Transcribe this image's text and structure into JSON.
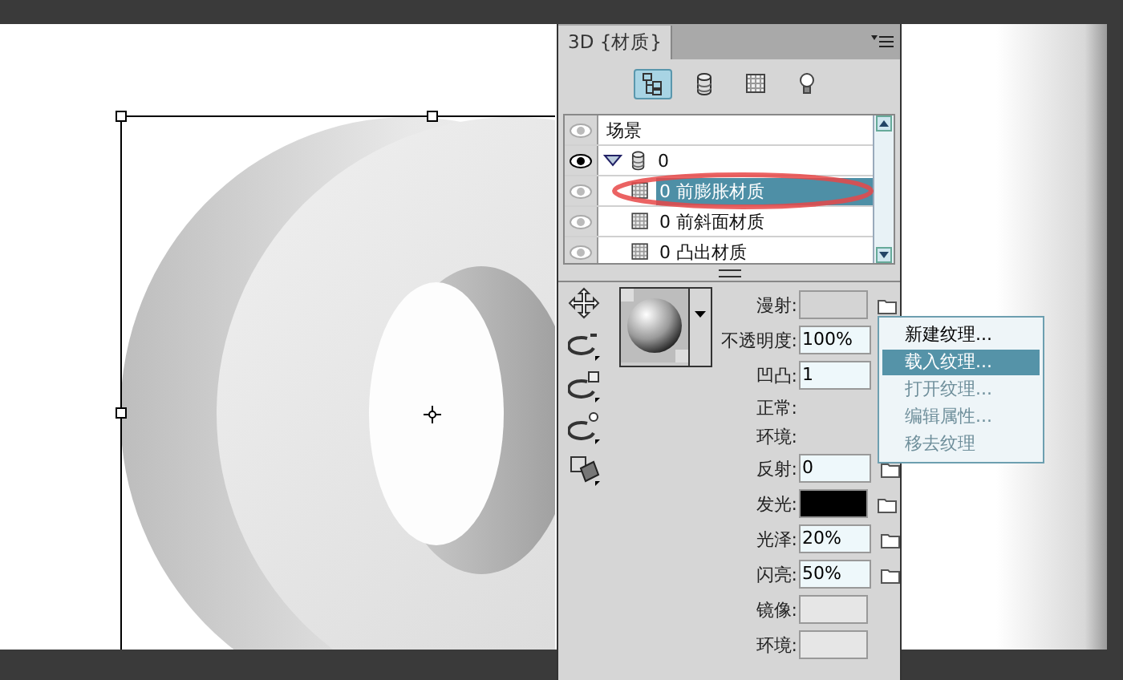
{
  "panel": {
    "tab": {
      "label": "3D {材质}",
      "selected": true
    },
    "toolbar": [
      {
        "kind": "scene",
        "selected": true
      },
      {
        "kind": "mesh",
        "selected": false
      },
      {
        "kind": "material",
        "selected": false
      },
      {
        "kind": "light",
        "selected": false
      }
    ],
    "layers": [
      {
        "kind": "scene",
        "label": "场景",
        "visible": false,
        "selected": false
      },
      {
        "kind": "mesh",
        "label": "0",
        "visible": true,
        "selected": false,
        "expanded": true,
        "children": [
          {
            "kind": "material",
            "label": "0 前膨胀材质",
            "visible": false,
            "selected": true
          },
          {
            "kind": "material",
            "label": "0 前斜面材质",
            "visible": false,
            "selected": false
          },
          {
            "kind": "material",
            "label": "0 凸出材质",
            "visible": false,
            "selected": false
          }
        ]
      }
    ],
    "properties": [
      {
        "kind": "swatch",
        "label": "漫射:",
        "color": "#d4d4d4",
        "folder": true
      },
      {
        "kind": "text",
        "label": "不透明度:",
        "value": "100%",
        "folder": false
      },
      {
        "kind": "text",
        "label": "凹凸:",
        "value": "1",
        "folder": false
      },
      {
        "kind": "label",
        "label": "正常:"
      },
      {
        "kind": "label",
        "label": "环境:"
      },
      {
        "kind": "text",
        "label": "反射:",
        "value": "0",
        "folder": true
      },
      {
        "kind": "swatch",
        "label": "发光:",
        "color": "#000000",
        "folder": true
      },
      {
        "kind": "text",
        "label": "光泽:",
        "value": "20%",
        "folder": true
      },
      {
        "kind": "text",
        "label": "闪亮:",
        "value": "50%",
        "folder": true
      },
      {
        "kind": "swatch",
        "label": "镜像:",
        "color": "#e6e6e6",
        "folder": false
      },
      {
        "kind": "swatch",
        "label": "环境:",
        "color": "#e6e6e6",
        "folder": false
      }
    ]
  },
  "texture_menu": [
    {
      "label": "新建纹理...",
      "disabled": false,
      "selected": false
    },
    {
      "label": "载入纹理...",
      "disabled": false,
      "selected": true
    },
    {
      "label": "打开纹理...",
      "disabled": true,
      "selected": false
    },
    {
      "label": "编辑属性...",
      "disabled": true,
      "selected": false
    },
    {
      "label": "移去纹理",
      "disabled": true,
      "selected": false
    }
  ]
}
